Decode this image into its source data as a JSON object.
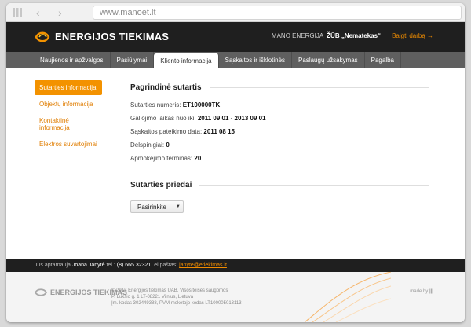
{
  "browser": {
    "url": "www.manoet.lt"
  },
  "header": {
    "logo_text": "ENERGIJOS TIEKIMAS",
    "mano_label": "MANO ENERGIJA",
    "company": "ŽŪB „Nematekas“",
    "logout": "Baigti darbą →"
  },
  "menu": {
    "items": [
      {
        "label": "Naujienos ir apžvalgos"
      },
      {
        "label": "Pasiūlymai"
      },
      {
        "label": "Kliento informacija"
      },
      {
        "label": "Sąskaitos ir išklotinės"
      },
      {
        "label": "Paslaugų užsakymas"
      },
      {
        "label": "Pagalba"
      }
    ]
  },
  "sidebar": {
    "items": [
      {
        "label": "Sutarties informacija"
      },
      {
        "label": "Objektų informacija"
      },
      {
        "label": "Kontaktinė informacija"
      },
      {
        "label": "Elektros suvartojimai"
      }
    ]
  },
  "main": {
    "title": "Pagrindinė sutartis",
    "rows": [
      {
        "label": "Sutarties numeris:",
        "value": "ET100000TK"
      },
      {
        "label": "Galiojimo laikas nuo iki:",
        "value": "2011 09 01 - 2013 09 01"
      },
      {
        "label": "Sąskaitos pateikimo data:",
        "value": "2011 08 15"
      },
      {
        "label": "Delspinigiai:",
        "value": "0"
      },
      {
        "label": "Apmokėjimo terminas:",
        "value": "20"
      }
    ],
    "section2_title": "Sutarties priedai",
    "dropdown_label": "Pasirinkite"
  },
  "contact": {
    "prefix": "Jus aptarnauja",
    "name": "Joana Janytė",
    "tel_label": "tel.:",
    "tel": "(8) 665 32321",
    "email_label": ", el.paštas:",
    "email": "janyte@etiekimas.lt"
  },
  "footer": {
    "logo_text": "ENERGIJOS TIEKIMAS",
    "legal1": "© 2012 Energijos tiekimas UAB. Visos teisės saugomos",
    "legal2": "P. Lukšio g. 1 LT-08221 Vilnius, Lietuva",
    "legal3": "Įm. kodas 302449388, PVM mokėtojo kodas LT100005013113",
    "madeby": "made by"
  },
  "colors": {
    "accent": "#f39200",
    "dark": "#1f1f1f",
    "menu": "#5f5f5f"
  }
}
